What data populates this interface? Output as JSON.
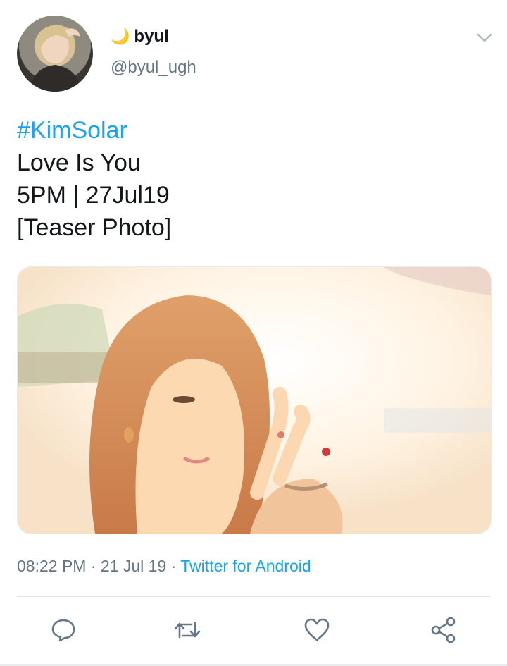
{
  "tweet": {
    "author": {
      "display_name": "byul",
      "name_emoji": "🌙",
      "handle": "@byul_ugh"
    },
    "text_lines": [
      "#KimSolar",
      "Love Is You",
      "5PM | 27Jul19",
      "[Teaser Photo]"
    ],
    "meta": {
      "time": "08:22 PM",
      "separator": " · ",
      "date": "21 Jul 19",
      "separator2": " · ",
      "source": "Twitter for Android"
    }
  },
  "icons": {
    "menu": "chevron-down-icon",
    "reply": "reply-icon",
    "retweet": "retweet-icon",
    "like": "heart-icon",
    "share": "share-icon"
  },
  "colors": {
    "link": "#1da1f2",
    "secondary_text": "#657786",
    "primary_text": "#14171a",
    "moon": "#f5a623"
  }
}
